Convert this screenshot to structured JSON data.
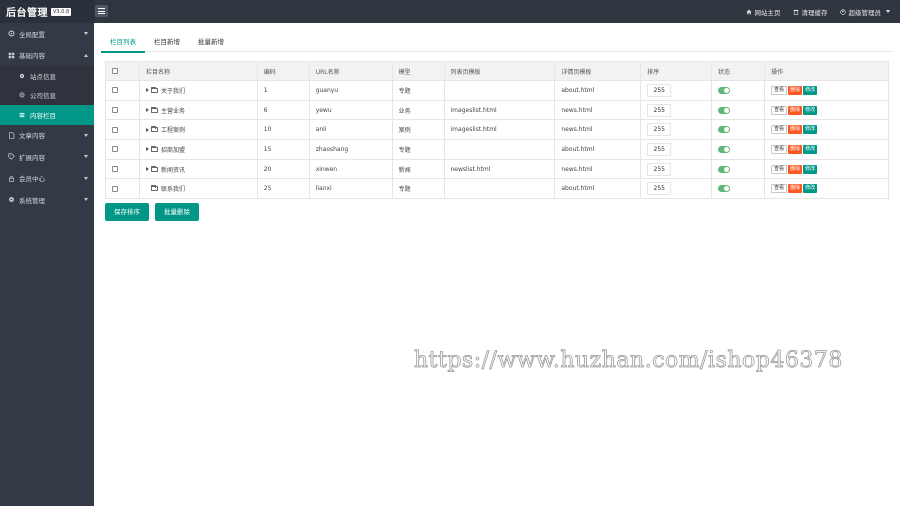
{
  "topbar": {
    "logo": "后台管理",
    "version": "V3.0.8",
    "links": [
      {
        "label": "网站主页",
        "icon": "home-icon"
      },
      {
        "label": "清理缓存",
        "icon": "trash-icon"
      },
      {
        "label": "超级管理员",
        "icon": "user-icon"
      }
    ]
  },
  "sidebar": {
    "items": [
      {
        "label": "全局配置",
        "icon": "gear-icon"
      },
      {
        "label": "基础内容",
        "icon": "grid-icon"
      },
      {
        "label": "文章内容",
        "icon": "file-icon"
      },
      {
        "label": "扩展内容",
        "icon": "tag-icon"
      },
      {
        "label": "会员中心",
        "icon": "lock-icon"
      },
      {
        "label": "系统管理",
        "icon": "cog-icon"
      }
    ],
    "subitems": [
      {
        "label": "站点信息",
        "icon": "gear-icon"
      },
      {
        "label": "公司信息",
        "icon": "settings-icon"
      },
      {
        "label": "内容栏目",
        "icon": "list-icon",
        "active": true
      }
    ]
  },
  "tabs": [
    "栏目列表",
    "栏目新增",
    "批量新增"
  ],
  "table": {
    "headers": [
      "栏目名称",
      "编码",
      "URL名称",
      "模型",
      "列表页模板",
      "详情页模板",
      "排序",
      "状态",
      "操作"
    ],
    "rows": [
      {
        "name": "关于我们",
        "code": "1",
        "url": "guanyu",
        "model": "专题",
        "list_tpl": "",
        "detail_tpl": "about.html",
        "sort": "255"
      },
      {
        "name": "主营业务",
        "code": "6",
        "url": "yewu",
        "model": "业务",
        "list_tpl": "imageslist.html",
        "detail_tpl": "news.html",
        "sort": "255"
      },
      {
        "name": "工程案例",
        "code": "10",
        "url": "anli",
        "model": "案例",
        "list_tpl": "imageslist.html",
        "detail_tpl": "news.html",
        "sort": "255"
      },
      {
        "name": "招商加盟",
        "code": "15",
        "url": "zhaoshang",
        "model": "专题",
        "list_tpl": "",
        "detail_tpl": "about.html",
        "sort": "255"
      },
      {
        "name": "新闻资讯",
        "code": "20",
        "url": "xinwen",
        "model": "新闻",
        "list_tpl": "newslist.html",
        "detail_tpl": "news.html",
        "sort": "255"
      },
      {
        "name": "联系我们",
        "code": "25",
        "url": "lianxi",
        "model": "专题",
        "list_tpl": "",
        "detail_tpl": "about.html",
        "sort": "255"
      }
    ],
    "op_labels": {
      "view": "查看",
      "delete": "删除",
      "edit": "修改"
    }
  },
  "buttons": {
    "save_sort": "保存排序",
    "batch_delete": "批量删除"
  },
  "watermark": "https://www.huzhan.com/ishop46378",
  "colors": {
    "accent": "#009688",
    "danger": "#ff5722",
    "switch_on": "#5fb878",
    "topbar": "#2f3640",
    "sidebar": "#343a45"
  }
}
